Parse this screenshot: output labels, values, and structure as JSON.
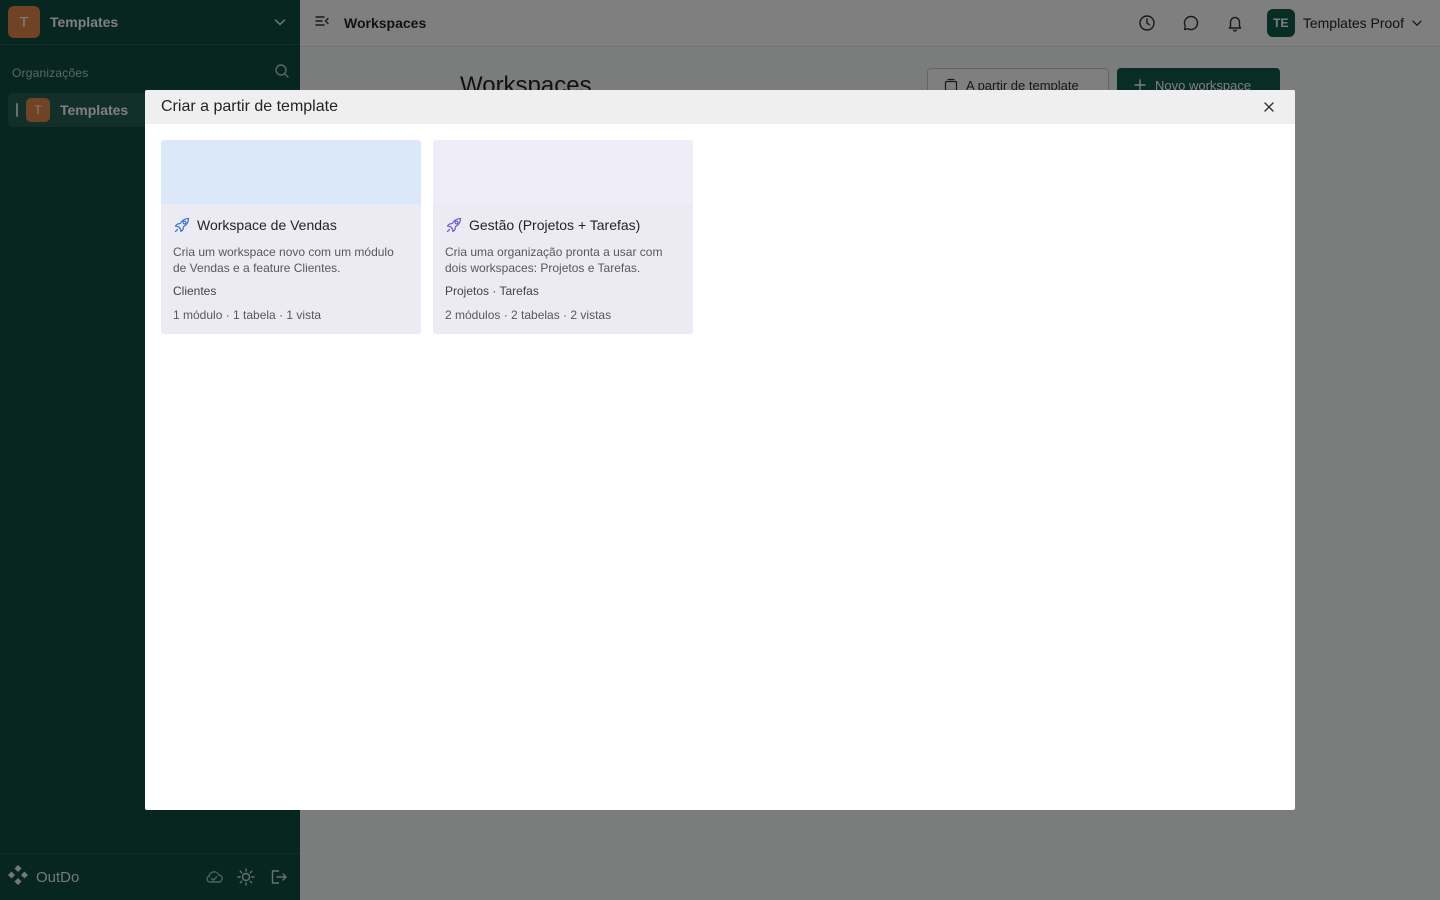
{
  "sidebar": {
    "org_avatar_letter": "T",
    "org_name": "Templates",
    "section_label": "Organizações",
    "items": [
      {
        "avatar_letter": "T",
        "label": "Templates"
      }
    ],
    "footer": {
      "brand": "OutDo"
    }
  },
  "topbar": {
    "title": "Workspaces",
    "user": {
      "initials": "TE",
      "name": "Templates Proof"
    }
  },
  "page": {
    "title": "Workspaces",
    "from_template_button": "A partir de template",
    "new_workspace_button": "Novo workspace"
  },
  "modal": {
    "title": "Criar a partir de template",
    "cards": [
      {
        "title": "Workspace de Vendas",
        "description": "Cria um workspace novo com um módulo de Vendas e a feature Clientes.",
        "tags": "Clientes",
        "meta": "1 módulo · 1 tabela · 1 vista",
        "banner_color": "#dbe8f9",
        "icon_color": "#3d7bd6"
      },
      {
        "title": "Gestão (Projetos + Tarefas)",
        "description": "Cria uma organização pronta a usar com dois workspaces: Projetos e Tarefas.",
        "tags": "Projetos · Tarefas",
        "meta": "2 módulos · 2 tabelas · 2 vistas",
        "banner_color": "#efedf8",
        "icon_color": "#7a5fd0"
      }
    ]
  },
  "colors": {
    "sidebar_bg": "#0f4d41",
    "accent": "#0f5a4b",
    "org_avatar": "#e0864a"
  }
}
